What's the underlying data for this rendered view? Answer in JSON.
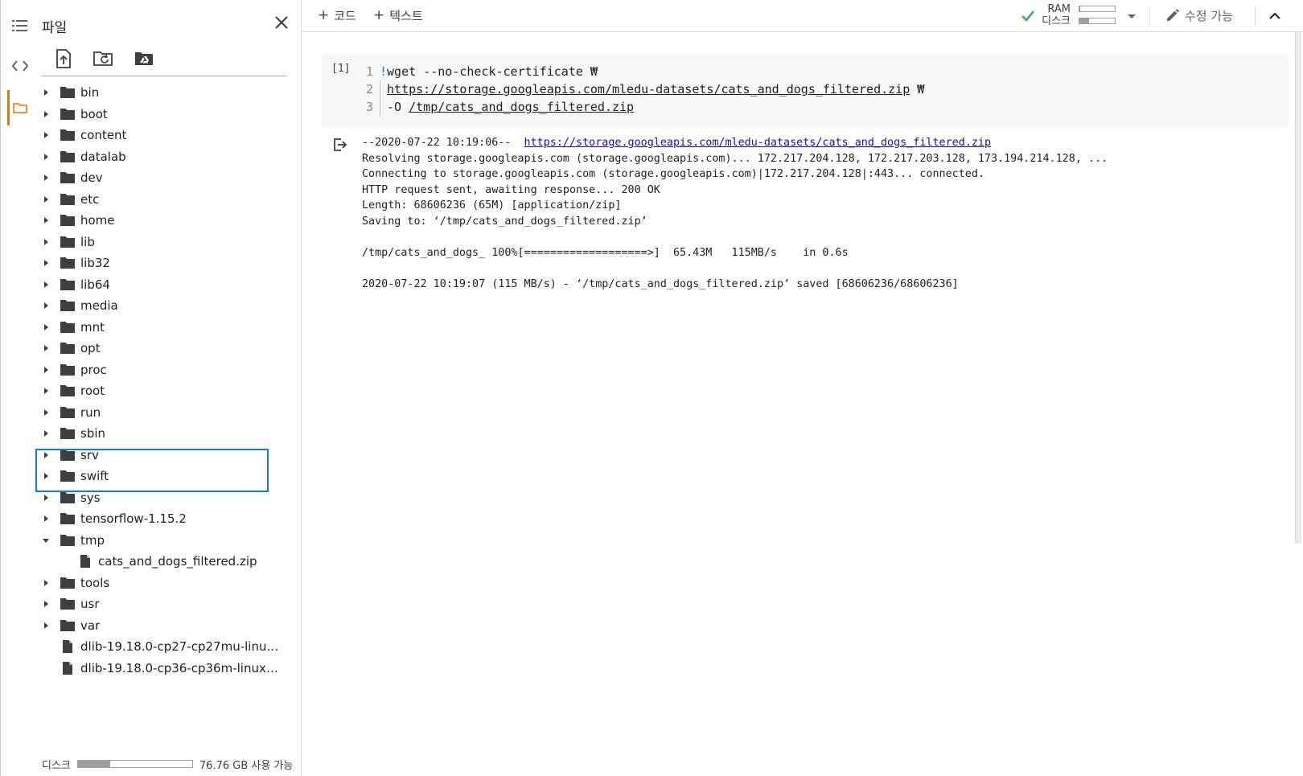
{
  "rail": {
    "items": [
      {
        "icon": "toc-icon"
      },
      {
        "icon": "code-icon"
      },
      {
        "icon": "folder-icon",
        "active": true
      }
    ]
  },
  "files_panel": {
    "title": "파일",
    "toolbar": [
      {
        "icon": "upload-file-icon"
      },
      {
        "icon": "refresh-folder-icon"
      },
      {
        "icon": "mount-drive-icon"
      }
    ],
    "tree": [
      {
        "label": "bin",
        "type": "folder",
        "expanded": false
      },
      {
        "label": "boot",
        "type": "folder",
        "expanded": false
      },
      {
        "label": "content",
        "type": "folder",
        "expanded": false
      },
      {
        "label": "datalab",
        "type": "folder",
        "expanded": false
      },
      {
        "label": "dev",
        "type": "folder",
        "expanded": false
      },
      {
        "label": "etc",
        "type": "folder",
        "expanded": false
      },
      {
        "label": "home",
        "type": "folder",
        "expanded": false
      },
      {
        "label": "lib",
        "type": "folder",
        "expanded": false
      },
      {
        "label": "lib32",
        "type": "folder",
        "expanded": false
      },
      {
        "label": "lib64",
        "type": "folder",
        "expanded": false
      },
      {
        "label": "media",
        "type": "folder",
        "expanded": false
      },
      {
        "label": "mnt",
        "type": "folder",
        "expanded": false
      },
      {
        "label": "opt",
        "type": "folder",
        "expanded": false
      },
      {
        "label": "proc",
        "type": "folder",
        "expanded": false
      },
      {
        "label": "root",
        "type": "folder",
        "expanded": false
      },
      {
        "label": "run",
        "type": "folder",
        "expanded": false
      },
      {
        "label": "sbin",
        "type": "folder",
        "expanded": false
      },
      {
        "label": "srv",
        "type": "folder",
        "expanded": false
      },
      {
        "label": "swift",
        "type": "folder",
        "expanded": false
      },
      {
        "label": "sys",
        "type": "folder",
        "expanded": false
      },
      {
        "label": "tensorflow-1.15.2",
        "type": "folder",
        "expanded": false
      },
      {
        "label": "tmp",
        "type": "folder",
        "expanded": true
      },
      {
        "label": "cats_and_dogs_filtered.zip",
        "type": "file",
        "child": true
      },
      {
        "label": "tools",
        "type": "folder",
        "expanded": false
      },
      {
        "label": "usr",
        "type": "folder",
        "expanded": false
      },
      {
        "label": "var",
        "type": "folder",
        "expanded": false
      },
      {
        "label": "dlib-19.18.0-cp27-cp27mu-linux_x8...",
        "type": "file"
      },
      {
        "label": "dlib-19.18.0-cp36-cp36m-linux_x86..."
      }
    ],
    "disk": {
      "label": "디스크",
      "usage_fraction": 0.28,
      "available_text": "76.76 GB 사용 가능"
    }
  },
  "topbar": {
    "add_code_label": "코드",
    "add_text_label": "텍스트",
    "ram_label": "RAM",
    "disk_label": "디스크",
    "ram_fraction": 0.02,
    "disk_fraction": 0.28,
    "edit_label": "수정 가능",
    "status_color": "#34a853"
  },
  "cell": {
    "exec_count": "[1]",
    "lines": [
      {
        "num": "1",
        "bang": "!",
        "text": "wget --no-check-certificate ₩"
      },
      {
        "num": "2",
        "text": "https://storage.googleapis.com/mledu-datasets/cats_and_dogs_filtered.zip",
        "suffix": " ₩"
      },
      {
        "num": "3",
        "prefix": "-O ",
        "text": "/tmp/cats_and_dogs_filtered.zip"
      }
    ]
  },
  "output": {
    "line1_prefix": "--2020-07-22 10:19:06--  ",
    "line1_link": "https://storage.googleapis.com/mledu-datasets/cats_and_dogs_filtered.zip",
    "line2": "Resolving storage.googleapis.com (storage.googleapis.com)... 172.217.204.128, 172.217.203.128, 173.194.214.128, ...",
    "line3": "Connecting to storage.googleapis.com (storage.googleapis.com)|172.217.204.128|:443... connected.",
    "line4": "HTTP request sent, awaiting response... 200 OK",
    "line5": "Length: 68606236 (65M) [application/zip]",
    "line6": "Saving to: ‘/tmp/cats_and_dogs_filtered.zip’",
    "line7": "",
    "line8": "/tmp/cats_and_dogs_ 100%[===================>]  65.43M   115MB/s    in 0.6s",
    "line9": "",
    "line10": "2020-07-22 10:19:07 (115 MB/s) - ‘/tmp/cats_and_dogs_filtered.zip’ saved [68606236/68606236]"
  }
}
